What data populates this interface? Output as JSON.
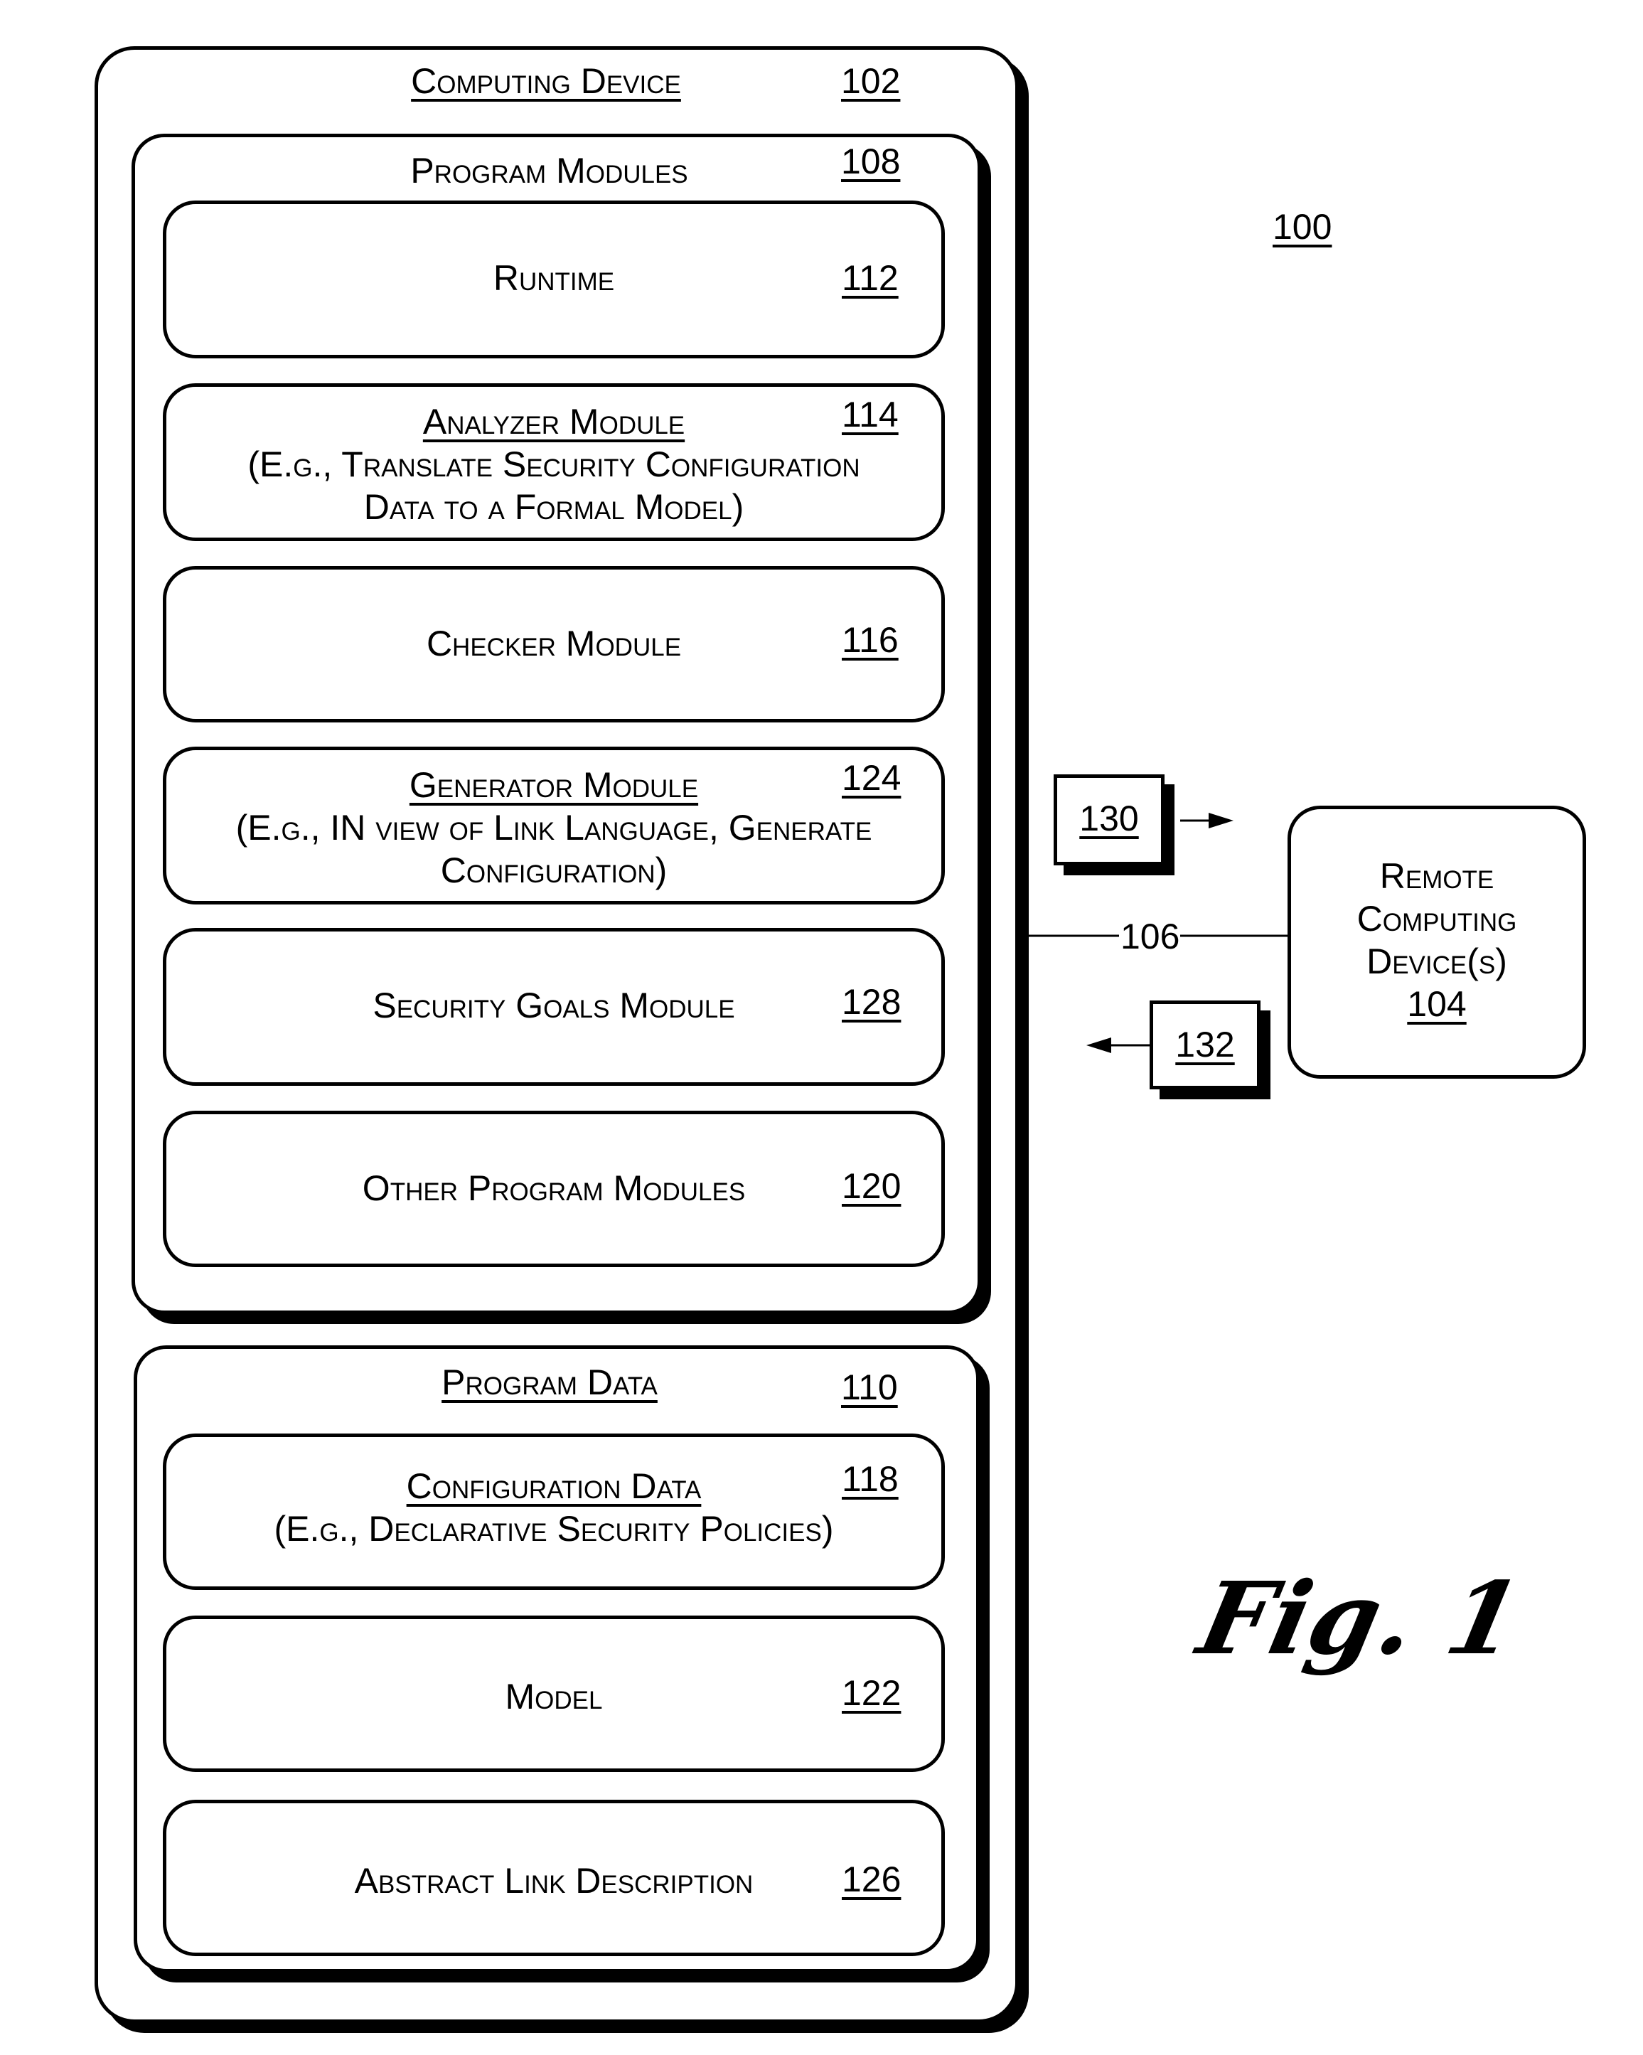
{
  "figure": {
    "number_label": "100",
    "caption": "Fig. 1"
  },
  "computing_device": {
    "title": "Computing Device",
    "ref": "102",
    "program_modules": {
      "title": "Program Modules",
      "ref": "108",
      "items": [
        {
          "title": "Runtime",
          "ref": "112",
          "title_underlined": false,
          "desc": []
        },
        {
          "title": "Analyzer Module",
          "ref": "114",
          "title_underlined": true,
          "desc": [
            "(E.g., Translate  Security Configuration",
            "Data to a Formal Model)"
          ]
        },
        {
          "title": "Checker Module",
          "ref": "116",
          "title_underlined": false,
          "desc": []
        },
        {
          "title": "Generator Module",
          "ref": "124",
          "title_underlined": true,
          "desc": [
            "(E.g., IN view of Link Language, Generate",
            "Configuration)"
          ]
        },
        {
          "title": "Security Goals Module",
          "ref": "128",
          "title_underlined": false,
          "desc": []
        },
        {
          "title": "Other Program Modules",
          "ref": "120",
          "title_underlined": false,
          "desc": []
        }
      ]
    },
    "program_data": {
      "title": "Program Data",
      "ref": "110",
      "items": [
        {
          "title": "Configuration Data",
          "ref": "118",
          "title_underlined": true,
          "desc": [
            "(E.g., Declarative Security Policies)"
          ]
        },
        {
          "title": "Model",
          "ref": "122",
          "title_underlined": false,
          "desc": []
        },
        {
          "title": "Abstract Link Description",
          "ref": "126",
          "title_underlined": false,
          "desc": []
        }
      ]
    }
  },
  "network": {
    "ref": "106"
  },
  "messages": [
    {
      "ref": "130",
      "direction": "right"
    },
    {
      "ref": "132",
      "direction": "left"
    }
  ],
  "remote_device": {
    "lines": [
      "Remote",
      "Computing",
      "Device(s)"
    ],
    "ref": "104"
  }
}
